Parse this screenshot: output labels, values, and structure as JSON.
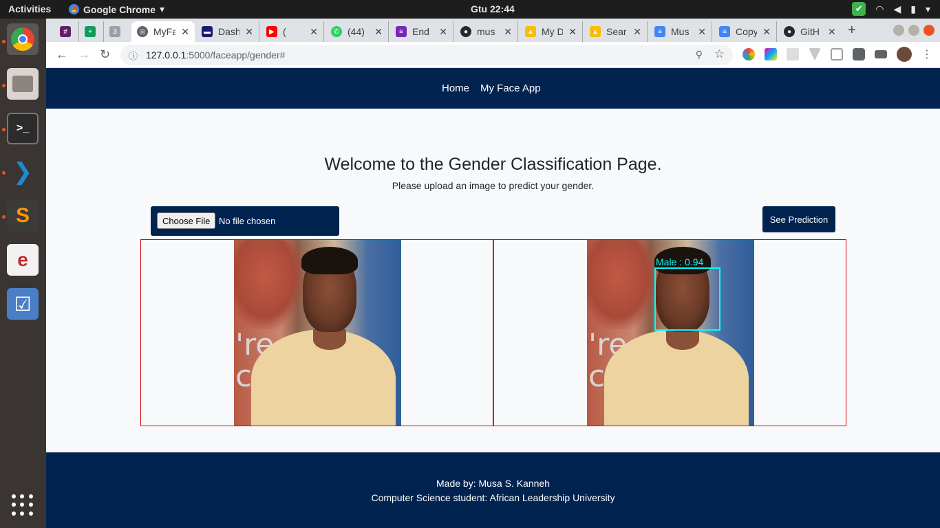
{
  "topbar": {
    "activities": "Activities",
    "app_name": "Google Chrome",
    "clock": "Gtu 22:44"
  },
  "browser": {
    "tabs": [
      {
        "label": "",
        "color": "#611f69"
      },
      {
        "label": "",
        "color": "#0f9d58"
      },
      {
        "label": "",
        "color": "#9aa0a6"
      },
      {
        "label": "MyFa",
        "color": "#5f6368"
      },
      {
        "label": "Dash",
        "color": "#1a1a6e"
      },
      {
        "label": "(",
        "color": "#ff0000"
      },
      {
        "label": "(44)",
        "color": "#25d366"
      },
      {
        "label": "End",
        "color": "#7627bb"
      },
      {
        "label": "mus",
        "color": "#24292e"
      },
      {
        "label": "My D",
        "color": "#fbbc04"
      },
      {
        "label": "Sear",
        "color": "#fbbc04"
      },
      {
        "label": "Mus",
        "color": "#4285f4"
      },
      {
        "label": "Copy",
        "color": "#4285f4"
      },
      {
        "label": "GitH",
        "color": "#24292e"
      }
    ],
    "url_host": "127.0.0.1",
    "url_path": ":5000/faceapp/gender#"
  },
  "nav": {
    "home": "Home",
    "face_app": "My Face App"
  },
  "main": {
    "title": "Welcome to the Gender Classification Page.",
    "subtitle": "Please upload an image to predict your gender.",
    "choose_file": "Choose File",
    "no_file": "No file chosen",
    "predict_button": "See Prediction",
    "prediction_label": "Male : 0.94"
  },
  "footer": {
    "made_by": "Made by: Musa S. Kanneh",
    "school": "Computer Science student:  African Leadership University"
  },
  "colors": {
    "navbar": "#012350",
    "box_border": "#d40000",
    "detection": "#00ffff"
  }
}
